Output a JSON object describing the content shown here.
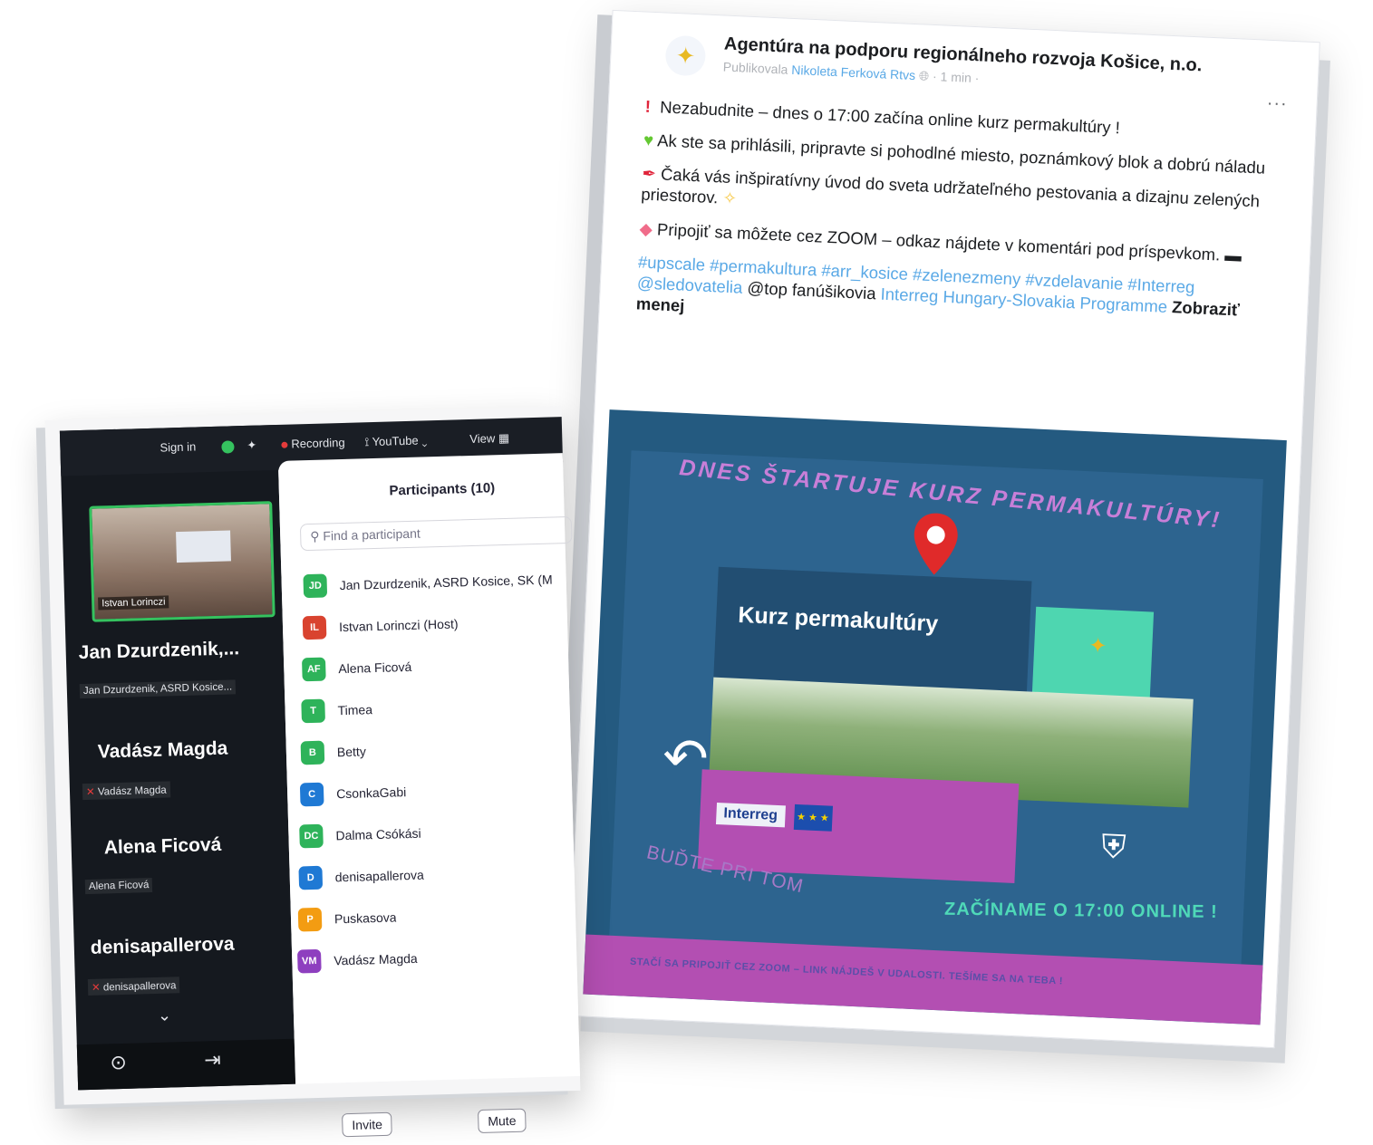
{
  "facebook_post": {
    "page_name": "Agentúra na podporu regionálneho rozvoja Košice, n.o.",
    "published_by_label": "Publikovala",
    "author": "Nikoleta Ferková Rtvs",
    "time": "· 1 min ·",
    "more_label": "···",
    "line1": "Nezabudnite – dnes o 17:00 začína online kurz permakultúry !",
    "line2": "Ak ste sa prihlásili, pripravte si pohodlné miesto, poznámkový blok a dobrú náladu",
    "line3": "Čaká vás inšpiratívny úvod do sveta udržateľného pestovania a dizajnu zelených priestorov.",
    "line4": "Pripojiť sa môžete cez ZOOM – odkaz nájdete v komentári pod príspevkom.",
    "hashtags": "#upscale #permakultura #arr_kosice  #zelenezmeny #vzdelavanie #Interreg @sledovatelia",
    "plain_mention": "@top fanúšikovia",
    "linked_page": "Interreg Hungary-Slovakia Programme",
    "show_less": "Zobraziť menej",
    "banner": {
      "headline": "DNES ŠTARTUJE KURZ PERMAKULTÚRY!",
      "course_title": "Kurz permakultúry",
      "interreg_logo": "Interreg",
      "bottom_left": "BUĎTE PRI TOM",
      "bottom_right": "ZAČÍNAME O  17:00  ONLINE !",
      "strip": "STAČÍ SA PRIPOJIŤ CEZ ZOOM – LINK NÁJDEŠ V UDALOSTI. TEŠÍME SA NA TEBA !"
    }
  },
  "zoom": {
    "topbar": {
      "sign_in": "Sign in",
      "recording": "Recording",
      "youtube": "YouTube ⌄",
      "view": "View"
    },
    "active_speaker_label": "Istvan Lorinczi",
    "tiles": [
      {
        "name": "Jan  Dzurdzenik,...",
        "sub": "Jan Dzurdzenik, ASRD Kosice..."
      },
      {
        "name": "Vadász Magda",
        "sub": "Vadász Magda"
      },
      {
        "name": "Alena Ficová",
        "sub": "Alena Ficová"
      },
      {
        "name": "denisapallerova",
        "sub": "denisapallerova"
      }
    ],
    "participants_title": "Participants (10)",
    "search_placeholder": "Find a participant",
    "participants": [
      {
        "initials": "JD",
        "name": "Jan Dzurdzenik, ASRD Kosice, SK (M",
        "color": "#2eb35a"
      },
      {
        "initials": "IL",
        "name": "Istvan Lorinczi (Host)",
        "color": "#d9432f"
      },
      {
        "initials": "AF",
        "name": "Alena Ficová",
        "color": "#2eb35a"
      },
      {
        "initials": "T",
        "name": "Timea",
        "color": "#2eb35a"
      },
      {
        "initials": "B",
        "name": "Betty",
        "color": "#2eb35a"
      },
      {
        "initials": "C",
        "name": "CsonkaGabi",
        "color": "#1f79d4"
      },
      {
        "initials": "DC",
        "name": "Dalma Csókási",
        "color": "#2eb35a"
      },
      {
        "initials": "D",
        "name": "denisapallerova",
        "color": "#1f79d4"
      },
      {
        "initials": "P",
        "name": "Puskasova",
        "color": "#f39c12"
      },
      {
        "initials": "VM",
        "name": "Vadász Magda",
        "color": "#8e3fbf"
      }
    ],
    "invite_label": "Invite",
    "mute_label": "Mute"
  }
}
